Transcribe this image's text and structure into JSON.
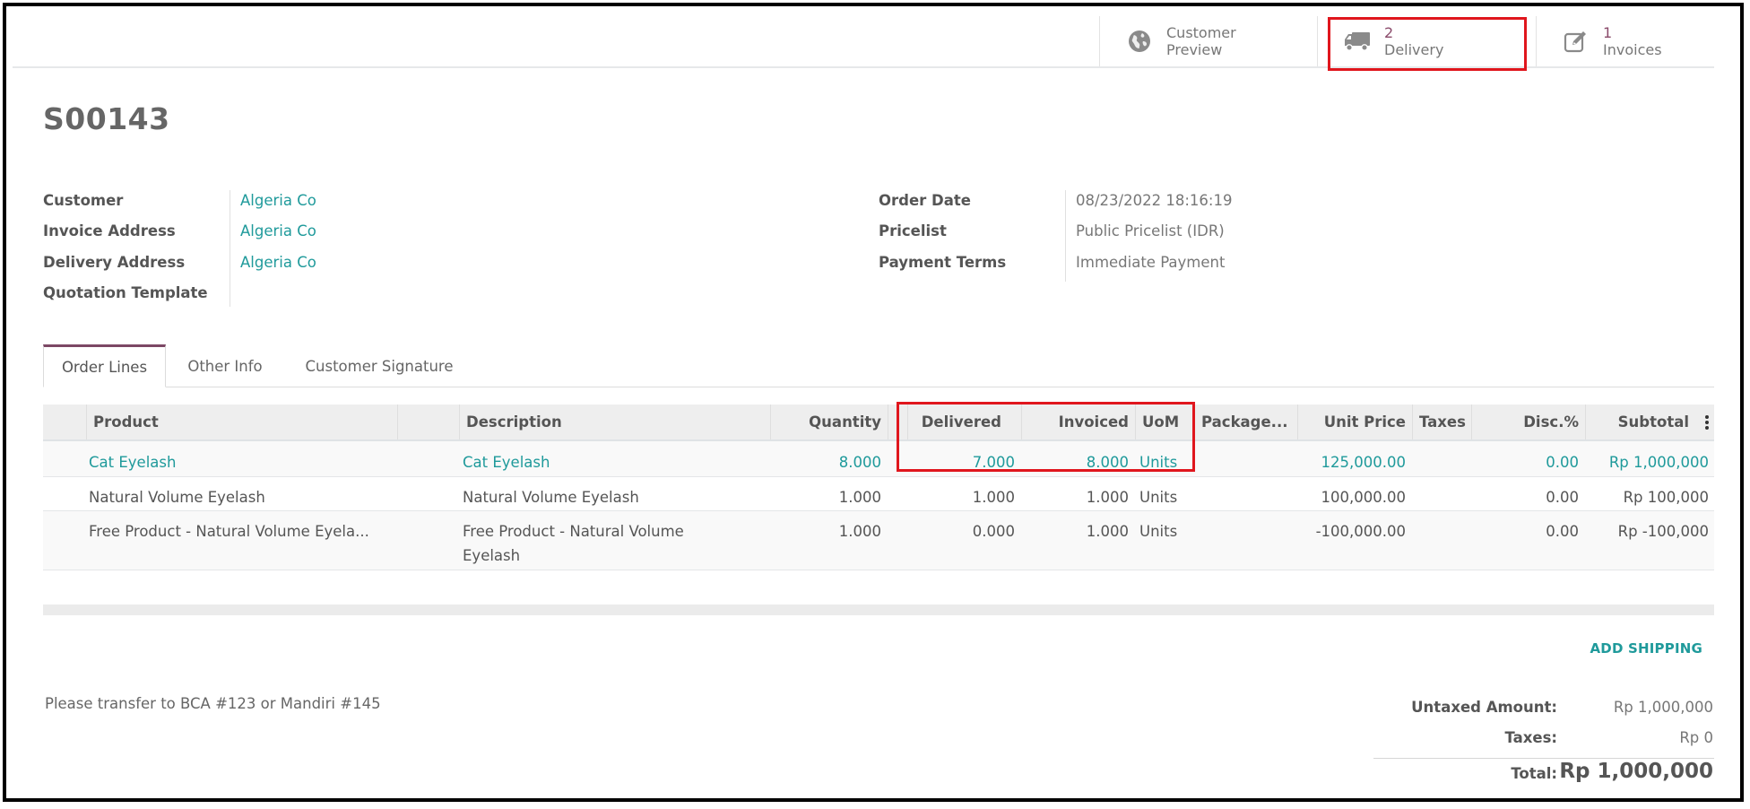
{
  "stat_buttons": [
    {
      "label_line1": "Customer",
      "label_line2": "Preview",
      "icon": "globe-icon"
    },
    {
      "count": "2",
      "label": "Delivery",
      "icon": "truck-icon",
      "highlighted": true
    },
    {
      "count": "1",
      "label": "Invoices",
      "icon": "pencil-square-icon"
    }
  ],
  "record": {
    "title": "S00143"
  },
  "fields_left": [
    {
      "label": "Customer",
      "value": "Algeria Co"
    },
    {
      "label": "Invoice Address",
      "value": "Algeria Co"
    },
    {
      "label": "Delivery Address",
      "value": "Algeria Co"
    },
    {
      "label": "Quotation Template",
      "value": ""
    }
  ],
  "fields_right": [
    {
      "label": "Order Date",
      "value": "08/23/2022 18:16:19"
    },
    {
      "label": "Pricelist",
      "value": "Public Pricelist (IDR)"
    },
    {
      "label": "Payment Terms",
      "value": "Immediate Payment"
    }
  ],
  "tabs": [
    {
      "label": "Order Lines",
      "active": true
    },
    {
      "label": "Other Info"
    },
    {
      "label": "Customer Signature"
    }
  ],
  "table": {
    "columns": [
      "Product",
      "Description",
      "Quantity",
      "Delivered",
      "Invoiced",
      "UoM",
      "Package...",
      "Unit Price",
      "Taxes",
      "Disc.%",
      "Subtotal"
    ],
    "rows": [
      {
        "product": "Cat Eyelash",
        "description": "Cat Eyelash",
        "quantity": "8.000",
        "delivered": "7.000",
        "invoiced": "8.000",
        "uom": "Units",
        "package": "",
        "unit_price": "125,000.00",
        "taxes": "",
        "discount": "0.00",
        "subtotal": "Rp 1,000,000"
      },
      {
        "product": "Natural Volume Eyelash",
        "description": "Natural Volume Eyelash",
        "quantity": "1.000",
        "delivered": "1.000",
        "invoiced": "1.000",
        "uom": "Units",
        "package": "",
        "unit_price": "100,000.00",
        "taxes": "",
        "discount": "0.00",
        "subtotal": "Rp 100,000"
      },
      {
        "product": "Free Product - Natural Volume Eyela...",
        "description_line1": "Free Product - Natural Volume",
        "description_line2": "Eyelash",
        "quantity": "1.000",
        "delivered": "0.000",
        "invoiced": "1.000",
        "uom": "Units",
        "package": "",
        "unit_price": "-100,000.00",
        "taxes": "",
        "discount": "0.00",
        "subtotal": "Rp -100,000"
      }
    ]
  },
  "add_shipping_label": "ADD SHIPPING",
  "note": "Please transfer to BCA #123 or Mandiri #145",
  "totals": {
    "untaxed_label": "Untaxed Amount:",
    "untaxed_value": "Rp 1,000,000",
    "taxes_label": "Taxes:",
    "taxes_value": "Rp 0",
    "total_label": "Total:",
    "total_value": "Rp 1,000,000"
  },
  "colors": {
    "link": "#1f9a9b",
    "highlight": "#e0161d",
    "tab_accent": "#7c4764"
  }
}
